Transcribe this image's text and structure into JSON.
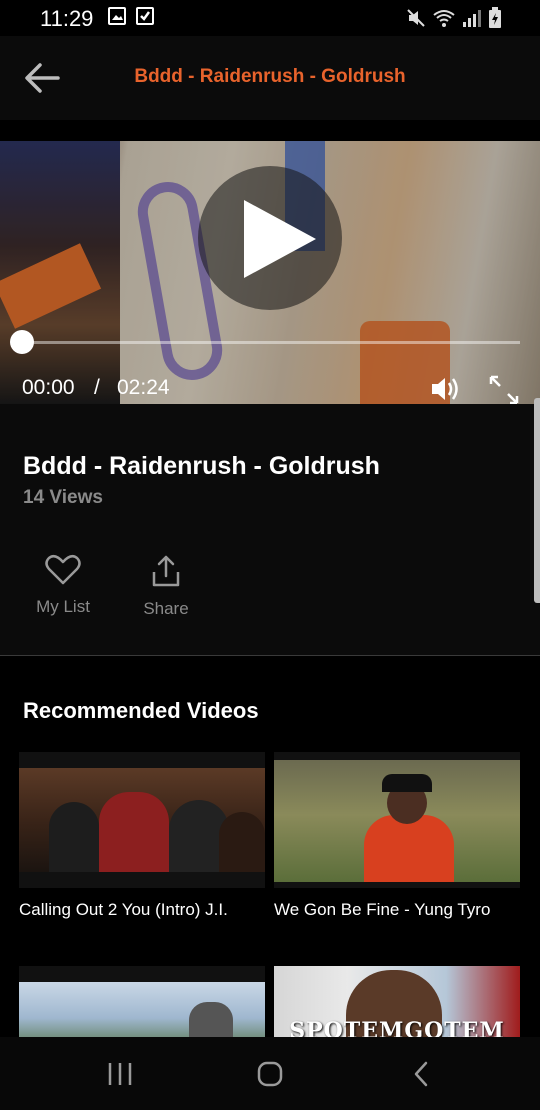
{
  "status_bar": {
    "time": "11:29",
    "left_icons": [
      "image-icon",
      "checkbox-icon"
    ],
    "right_icons": [
      "mute-icon",
      "wifi-icon",
      "signal-icon",
      "battery-icon"
    ]
  },
  "app_bar": {
    "title": "Bddd - Raidenrush - Goldrush",
    "title_color": "#e8632c"
  },
  "player": {
    "current_time": "00:00",
    "separator": "/",
    "duration": "02:24",
    "progress": 0
  },
  "video": {
    "title": "Bddd - Raidenrush - Goldrush",
    "views": "14 Views",
    "actions": [
      {
        "label": "My List",
        "icon": "heart-icon"
      },
      {
        "label": "Share",
        "icon": "share-icon"
      }
    ]
  },
  "recommended": {
    "heading": "Recommended Videos",
    "items": [
      {
        "title": "Calling Out 2 You (Intro) J.I."
      },
      {
        "title": "We Gon Be Fine - Yung Tyro"
      },
      {
        "title": ""
      },
      {
        "title": "",
        "thumb_text": "SPOTEMGOTEM"
      }
    ]
  },
  "nav_bar": {
    "buttons": [
      "recents-icon",
      "home-icon",
      "back-icon"
    ]
  }
}
